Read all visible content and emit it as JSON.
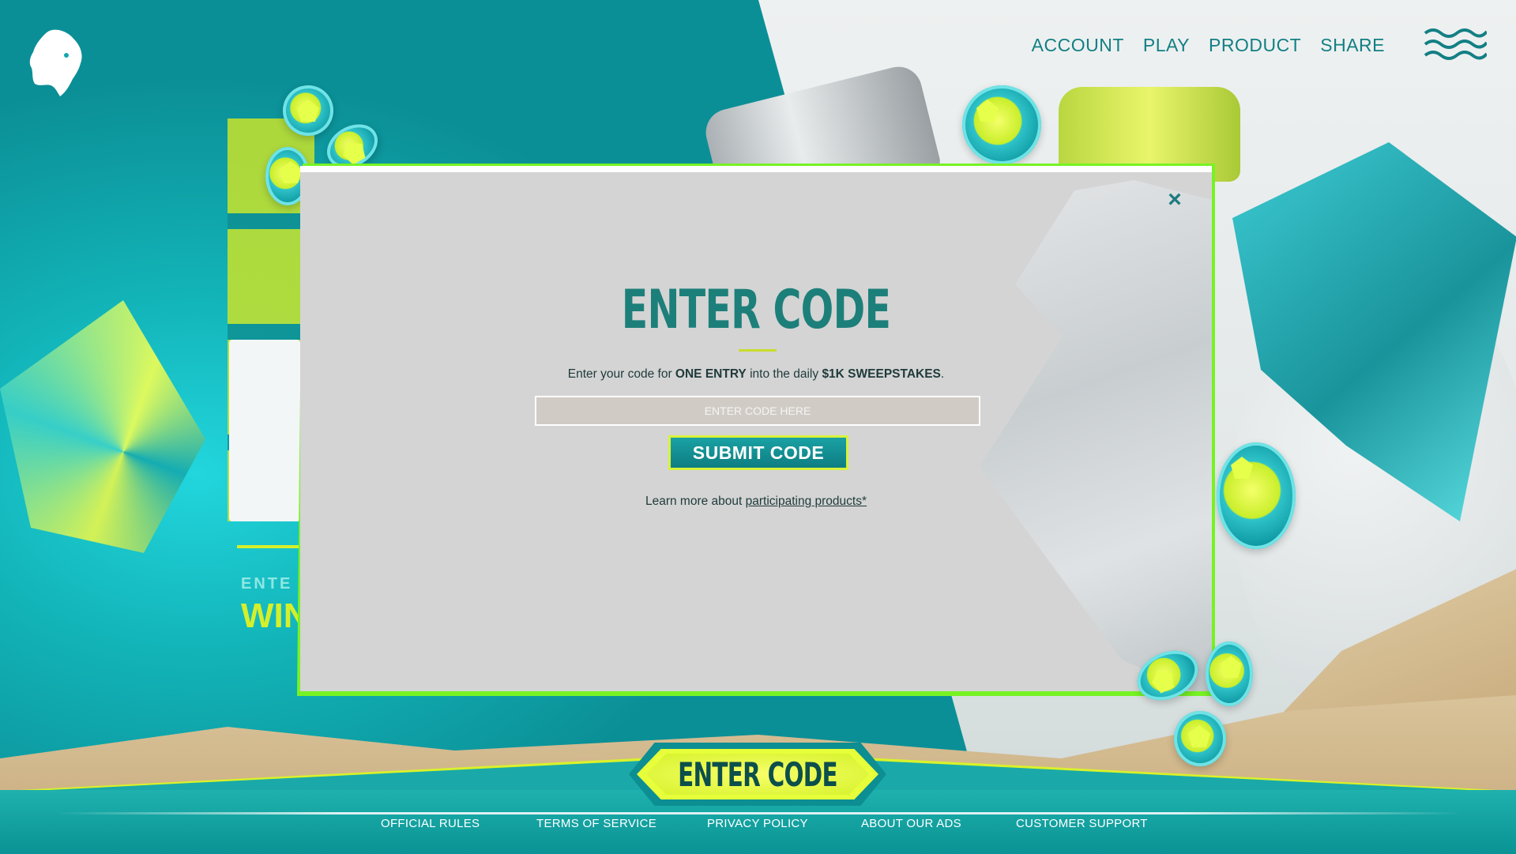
{
  "header": {
    "logo_name": "lion-head-logo",
    "nav": [
      {
        "label": "ACCOUNT"
      },
      {
        "label": "PLAY"
      },
      {
        "label": "PRODUCT"
      },
      {
        "label": "SHARE"
      }
    ],
    "menu_icon": "wave-menu-icon"
  },
  "modal": {
    "title": "ENTER CODE",
    "close_glyph": "×",
    "desc_prefix": "Enter your code for ",
    "desc_bold1": "ONE ENTRY",
    "desc_mid": " into the daily ",
    "desc_bold2": "$1K SWEEPSTAKES",
    "desc_suffix": ".",
    "input_placeholder": "ENTER CODE HERE",
    "input_value": "",
    "submit_label": "SUBMIT CODE",
    "learn_prefix": "Learn more about ",
    "learn_link": "participating products*"
  },
  "background": {
    "text_fragment_1": "ENTE",
    "text_fragment_2": "WIN"
  },
  "cta": {
    "label": "ENTER CODE"
  },
  "footer": {
    "links": [
      {
        "label": "OFFICIAL RULES"
      },
      {
        "label": "TERMS OF SERVICE"
      },
      {
        "label": "PRIVACY POLICY"
      },
      {
        "label": "ABOUT OUR ADS"
      },
      {
        "label": "CUSTOMER SUPPORT"
      }
    ]
  },
  "colors": {
    "teal": "#0fa7a8",
    "brand_dark_teal": "#1d7f7a",
    "lime": "#77f224",
    "yellow": "#d9f22a",
    "modal_bg": "#d4d4d4"
  }
}
